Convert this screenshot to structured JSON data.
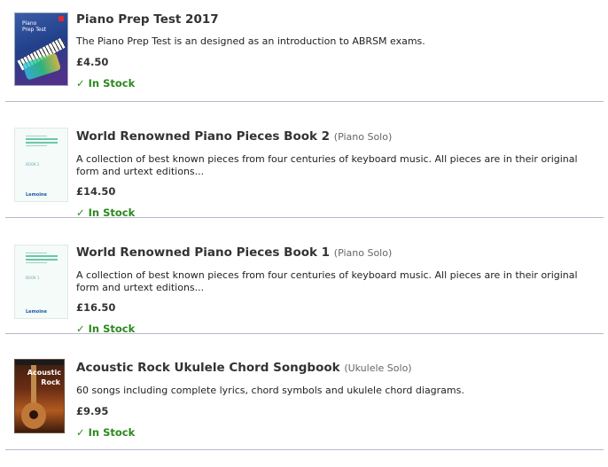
{
  "products": [
    {
      "title": "Piano Prep Test 2017",
      "category": "",
      "description": "The Piano Prep Test is an designed as an introduction to ABRSM exams.",
      "price": "£4.50",
      "stock_label": "In Stock",
      "stock_icon": "check-icon",
      "cover_text": [
        "Piano",
        "Prep Test"
      ]
    },
    {
      "title": "World Renowned Piano Pieces Book 2",
      "category": "(Piano Solo)",
      "description": "A collection of best known pieces from four centuries of keyboard music. All pieces are in their original form and urtext editions...",
      "price": "£14.50",
      "stock_label": "In Stock",
      "stock_icon": "check-icon",
      "cover_text": [
        "BOOK 2",
        "Lemoine"
      ]
    },
    {
      "title": "World Renowned Piano Pieces Book 1",
      "category": "(Piano Solo)",
      "description": "A collection of best known pieces from four centuries of keyboard music. All pieces are in their original form and urtext editions...",
      "price": "£16.50",
      "stock_label": "In Stock",
      "stock_icon": "check-icon",
      "cover_text": [
        "BOOK 1",
        "Lemoine"
      ]
    },
    {
      "title": "Acoustic Rock Ukulele Chord Songbook",
      "category": "(Ukulele Solo)",
      "description": "60 songs including complete lyrics, chord symbols and ukulele chord diagrams.",
      "price": "£9.95",
      "stock_label": "In Stock",
      "stock_icon": "check-icon",
      "cover_text": [
        "Acoustic",
        "Rock"
      ]
    }
  ],
  "colors": {
    "in_stock": "#2a8a1c",
    "separator": "#b8b8cc",
    "title_text": "#333333"
  },
  "check_glyph": "✓"
}
